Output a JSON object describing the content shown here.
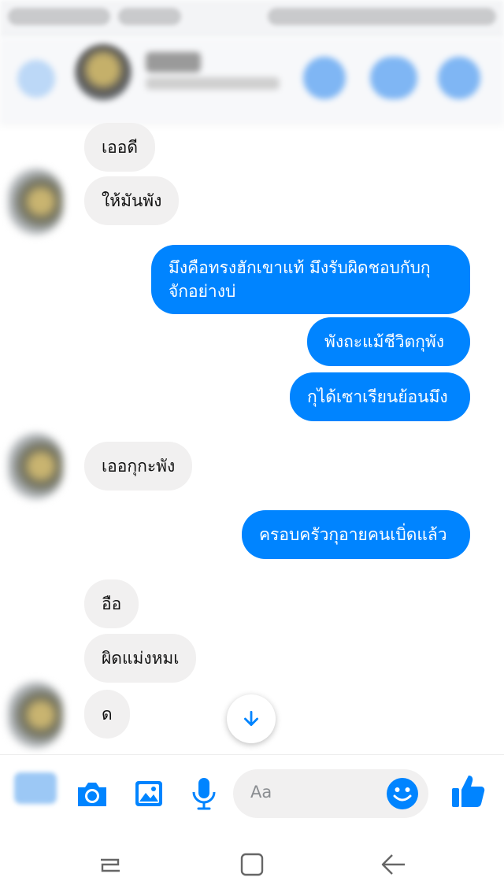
{
  "messages": [
    {
      "side": "in",
      "text": "เออดี"
    },
    {
      "side": "in",
      "text": "ให้มันพัง"
    },
    {
      "side": "out",
      "text": "มึงคือทรงฮักเขาแท้ มึงรับผิดชอบกับกุ\nจักอย่างบ่"
    },
    {
      "side": "out",
      "text": "พังถะแม้ชีวิตกุพัง"
    },
    {
      "side": "out",
      "text": "กุได้เซาเรียนย้อนมึง"
    },
    {
      "side": "in",
      "text": "เออกุกะพัง"
    },
    {
      "side": "out",
      "text": "ครอบครัวกุอายคนเบิ่ดแล้ว"
    },
    {
      "side": "in",
      "text": "อือ"
    },
    {
      "side": "in",
      "text": "ผิดแม่งหมเ"
    },
    {
      "side": "in",
      "text": "ด"
    }
  ],
  "composer": {
    "placeholder": "Aa",
    "icons": [
      "apps-icon",
      "camera-icon",
      "gallery-icon",
      "microphone-icon",
      "emoji-icon",
      "thumbs-up-icon"
    ]
  },
  "colors": {
    "outgoing_bubble": "#0084ff",
    "incoming_bubble": "#f1f0f0",
    "accent": "#0084ff"
  }
}
